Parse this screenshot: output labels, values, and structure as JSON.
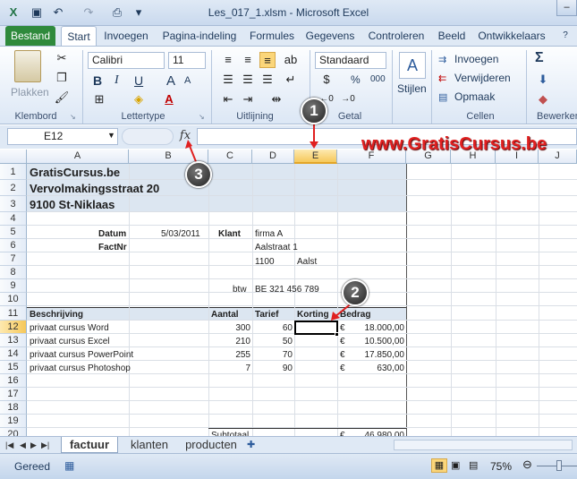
{
  "window": {
    "title": "Les_017_1.xlsm  -  Microsoft Excel",
    "minimize": "–"
  },
  "tabs": [
    "Bestand",
    "Start",
    "Invoegen",
    "Pagina-indeling",
    "Formules",
    "Gegevens",
    "Controleren",
    "Beeld",
    "Ontwikkelaars"
  ],
  "ribbon": {
    "clipboard": {
      "paste": "Plakken",
      "label": "Klembord"
    },
    "font": {
      "name": "Calibri",
      "size": "11",
      "bold": "B",
      "italic": "I",
      "underline": "U",
      "grow": "A",
      "shrink": "A",
      "label": "Lettertype"
    },
    "alignment": {
      "label": "Uitlijning"
    },
    "number": {
      "format": "Standaard",
      "percent": "%",
      "thousands": "000",
      "label": "Getal"
    },
    "styles": {
      "label": "Stijlen"
    },
    "cells": {
      "insert": "Invoegen",
      "delete": "Verwijderen",
      "format": "Opmaak",
      "label": "Cellen"
    },
    "editing": {
      "sum": "Σ",
      "label": "Bewerken"
    }
  },
  "formula_bar": {
    "name_box": "E12",
    "fx": "fx",
    "formula": ""
  },
  "columns": [
    "A",
    "B",
    "C",
    "D",
    "E",
    "F",
    "G",
    "H",
    "I",
    "J"
  ],
  "rows": [
    "1",
    "2",
    "3",
    "4",
    "5",
    "6",
    "7",
    "8",
    "9",
    "10",
    "11",
    "12",
    "13",
    "14",
    "15",
    "16",
    "17",
    "18",
    "19",
    "20"
  ],
  "header": {
    "company": "GratisCursus.be",
    "street": "Vervolmakingsstraat 20",
    "city": "9100 St-Niklaas"
  },
  "invoice": {
    "datum_label": "Datum",
    "datum": "5/03/2011",
    "klant_label": "Klant",
    "klant": "firma A",
    "factnr_label": "FactNr",
    "address": "Aalstraat 1",
    "postcode": "1100",
    "gemeente": "Aalst",
    "btw_label": "btw",
    "btw": "BE 321 456 789"
  },
  "table": {
    "headers": [
      "Beschrijving",
      "Aantal",
      "Tarief",
      "Korting",
      "Bedrag"
    ],
    "rows": [
      {
        "desc": "privaat cursus Word",
        "aantal": "300",
        "tarief": "60",
        "cur": "€",
        "bedrag": "18.000,00"
      },
      {
        "desc": "privaat cursus Excel",
        "aantal": "210",
        "tarief": "50",
        "cur": "€",
        "bedrag": "10.500,00"
      },
      {
        "desc": "privaat cursus PowerPoint",
        "aantal": "255",
        "tarief": "70",
        "cur": "€",
        "bedrag": "17.850,00"
      },
      {
        "desc": "privaat cursus Photoshop",
        "aantal": "7",
        "tarief": "90",
        "cur": "€",
        "bedrag": "630,00"
      }
    ],
    "subtotal_label": "Subtotaal",
    "subtotal_cur": "€",
    "subtotal": "46.980,00"
  },
  "sheets": [
    "factuur",
    "klanten",
    "producten"
  ],
  "status": {
    "ready": "Gereed",
    "zoom": "75%"
  },
  "callouts": [
    "1",
    "2",
    "3"
  ],
  "watermark": "www.GratisCursus.be",
  "colors": {
    "accent": "#2f8a3c",
    "header_fill": "#dce6f1",
    "selected_col": "#f8d98c",
    "callout": "#e02020"
  }
}
